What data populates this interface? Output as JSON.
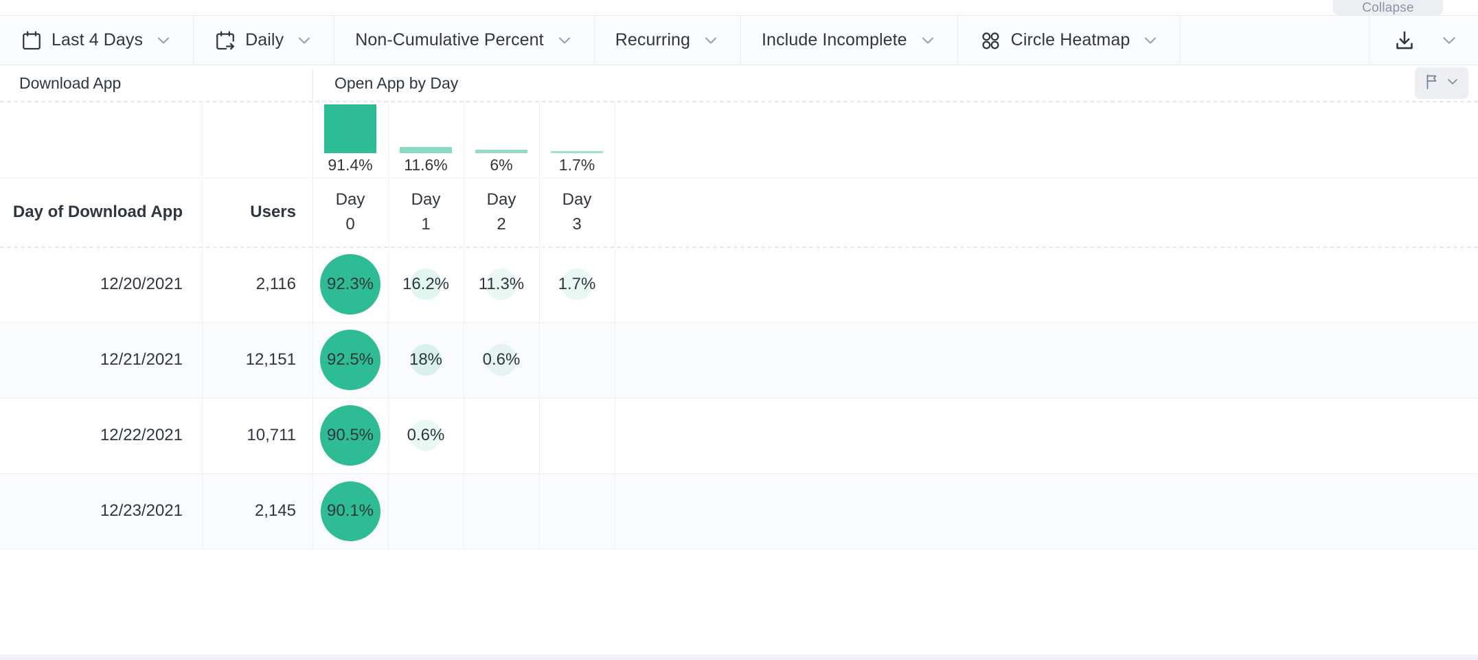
{
  "window": {
    "collapse_label": "Collapse"
  },
  "toolbar": {
    "items": [
      {
        "icon": "calendar-icon",
        "label": "Last 4 Days",
        "chevron": "chevron-down-icon",
        "name": "date-range-selector"
      },
      {
        "icon": "calendar-arrow-icon",
        "label": "Daily",
        "chevron": "chevron-down-icon",
        "name": "granularity-selector"
      },
      {
        "icon": "none",
        "label": "Non-Cumulative Percent",
        "chevron": "chevron-down-icon",
        "name": "measure-selector"
      },
      {
        "icon": "none",
        "label": "Recurring",
        "chevron": "chevron-down-icon",
        "name": "retention-type-selector"
      },
      {
        "icon": "none",
        "label": "Include Incomplete",
        "chevron": "chevron-down-icon",
        "name": "completeness-selector"
      },
      {
        "icon": "four-circles-icon",
        "label": "Circle Heatmap",
        "chevron": "chevron-down-icon",
        "name": "visualization-selector"
      }
    ],
    "export": {
      "icon": "download-icon",
      "chevron": "chevron-down-icon",
      "name": "export-button"
    }
  },
  "group_headers": [
    {
      "label": "Download App",
      "name": "group-header-download-app"
    },
    {
      "label": "Open App by Day",
      "name": "group-header-open-app-by-day"
    }
  ],
  "flag_control": {
    "icon": "flag-icon",
    "chevron": "chevron-down-icon"
  },
  "table": {
    "columns": [
      {
        "key": "date",
        "label": "Day of Download App"
      },
      {
        "key": "users",
        "label": "Users"
      }
    ],
    "day_columns": [
      "Day\n0",
      "Day\n1",
      "Day\n2",
      "Day\n3"
    ],
    "day_labels": [
      {
        "top": "Day",
        "bottom": "0"
      },
      {
        "top": "Day",
        "bottom": "1"
      },
      {
        "top": "Day",
        "bottom": "2"
      },
      {
        "top": "Day",
        "bottom": "3"
      }
    ],
    "summary": [
      {
        "label": "91.4%",
        "value": 91.4
      },
      {
        "label": "11.6%",
        "value": 11.6
      },
      {
        "label": "6%",
        "value": 6.0
      },
      {
        "label": "1.7%",
        "value": 1.7
      }
    ],
    "rows": [
      {
        "date": "12/20/2021",
        "users": "2,116",
        "cells": [
          {
            "label": "92.3%",
            "value": 92.3
          },
          {
            "label": "16.2%",
            "value": 16.2
          },
          {
            "label": "11.3%",
            "value": 11.3
          },
          {
            "label": "1.7%",
            "value": 1.7
          }
        ]
      },
      {
        "date": "12/21/2021",
        "users": "12,151",
        "cells": [
          {
            "label": "92.5%",
            "value": 92.5
          },
          {
            "label": "18%",
            "value": 18.0
          },
          {
            "label": "0.6%",
            "value": 0.6
          },
          {
            "label": "",
            "value": null
          }
        ]
      },
      {
        "date": "12/22/2021",
        "users": "10,711",
        "cells": [
          {
            "label": "90.5%",
            "value": 90.5
          },
          {
            "label": "0.6%",
            "value": 0.6
          },
          {
            "label": "",
            "value": null
          },
          {
            "label": "",
            "value": null
          }
        ]
      },
      {
        "date": "12/23/2021",
        "users": "2,145",
        "cells": [
          {
            "label": "90.1%",
            "value": 90.1
          },
          {
            "label": "",
            "value": null
          },
          {
            "label": "",
            "value": null
          },
          {
            "label": "",
            "value": null
          }
        ]
      }
    ]
  },
  "chart_data": {
    "type": "heatmap",
    "title": "Open App by Day",
    "subtitle": "Download App",
    "xlabel": "Day",
    "ylabel": "Day of Download App",
    "categories": [
      "Day 0",
      "Day 1",
      "Day 2",
      "Day 3"
    ],
    "row_labels": [
      "12/20/2021",
      "12/21/2021",
      "12/22/2021",
      "12/23/2021"
    ],
    "row_users": [
      2116,
      12151,
      10711,
      2145
    ],
    "summary_values": [
      91.4,
      11.6,
      6.0,
      1.7
    ],
    "values": [
      [
        92.3,
        16.2,
        11.3,
        1.7
      ],
      [
        92.5,
        18.0,
        0.6,
        null
      ],
      [
        90.5,
        0.6,
        null,
        null
      ],
      [
        90.1,
        null,
        null,
        null
      ]
    ],
    "unit": "percent",
    "accent_color": "#2dbc93",
    "legend": "none",
    "grid": true
  },
  "colors": {
    "accent": "#2dbc93",
    "text": "#2f3640",
    "muted": "#8a93a5",
    "grid": "#eef0f4",
    "toolbar_bg": "#fbfcfd",
    "row_alt": "#fafbfc"
  }
}
